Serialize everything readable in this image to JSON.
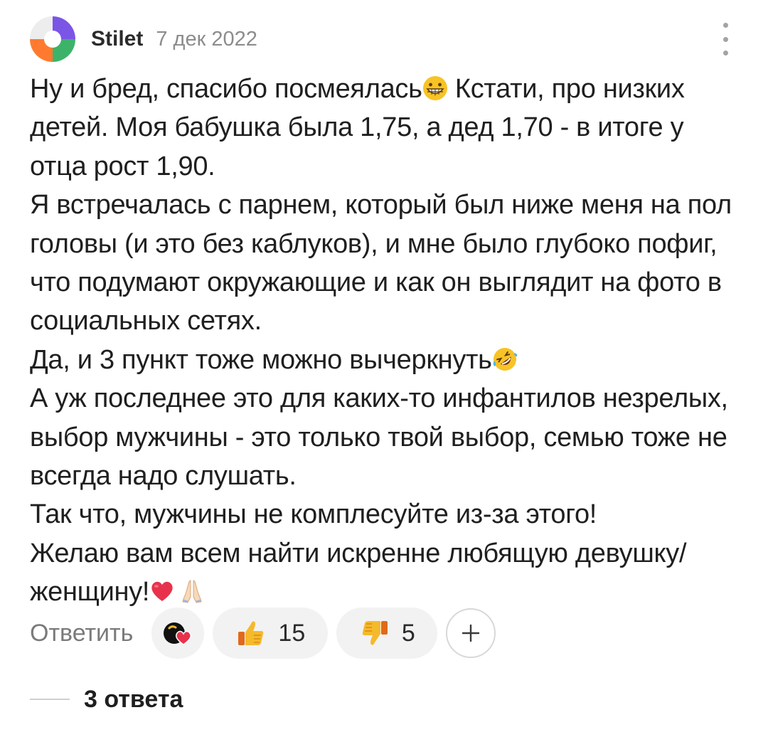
{
  "comment": {
    "author": "Stilet",
    "date": "7 дек 2022",
    "avatar_icon": "four-color-avatar-icon",
    "more_icon": "vertical-dots-icon",
    "paragraphs": [
      {
        "text": "Ну и бред, спасибо посмеялась",
        "emoji": "grinning-face-icon",
        "after": " Кстати, про низких детей. Моя бабушка была 1,75, а дед 1,70 - в итоге у отца рост 1,90."
      },
      {
        "text": "Я встречалась с парнем, который был ниже меня на пол головы (и это без каблуков), и мне было глубоко пофиг, что подумают окружающие и как он выглядит на фото в социальных сетях."
      },
      {
        "text": "Да, и 3 пункт тоже можно вычеркнуть",
        "emoji": "rolling-laughing-face-icon"
      },
      {
        "text": "А уж последнее это для каких-то инфантилов незрелых, выбор мужчины - это только твой выбор, семью тоже не всегда надо слушать."
      },
      {
        "text": "Так что, мужчины не комплесуйте из-за этого!"
      },
      {
        "text": "Желаю вам всем найти искренне любящую девушку/женщину!",
        "emoji": "red-heart-icon",
        "emoji2": "folded-hands-icon"
      }
    ]
  },
  "actions": {
    "reply_label": "Ответить",
    "badge_icon": "author-heart-badge-icon",
    "like_icon": "thumbs-up-icon",
    "like_count": "15",
    "dislike_icon": "thumbs-down-icon",
    "dislike_count": "5",
    "add_icon": "plus-icon"
  },
  "replies": {
    "label": "3 ответа"
  },
  "colors": {
    "text": "#1f1f1f",
    "muted": "#8c8c8c",
    "pill_bg": "#f2f2f2",
    "like_yellow": "#f5b92c",
    "heart_red": "#e8324b"
  }
}
